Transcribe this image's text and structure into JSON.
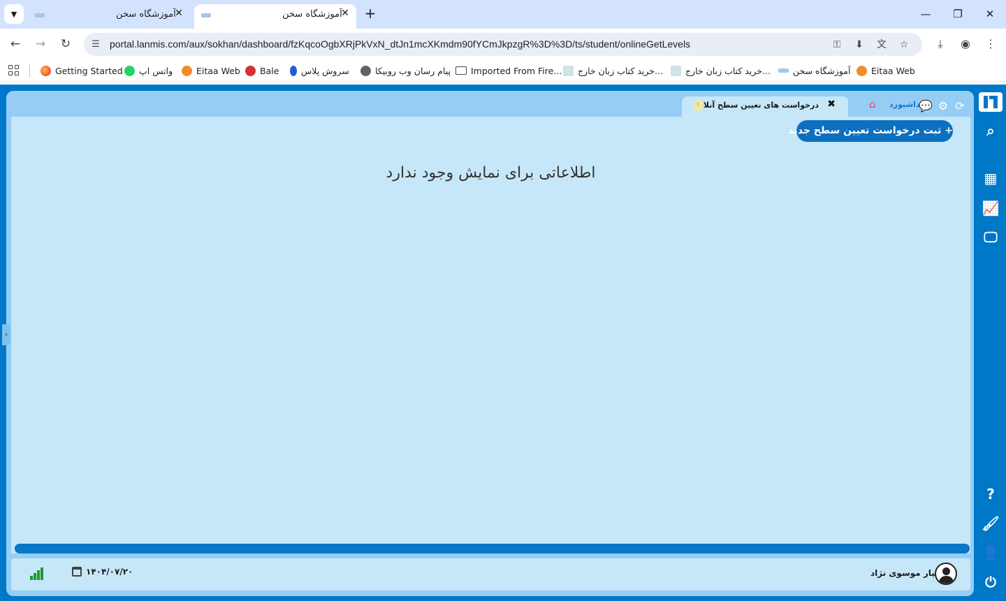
{
  "browser": {
    "tabs": [
      {
        "title": "آموزشگاه سخن",
        "active": false
      },
      {
        "title": "آموزشگاه سخن",
        "active": true
      }
    ],
    "url": "portal.lanmis.com/aux/sokhan/dashboard/fzKqcoOgbXRjPkVxN_dtJn1mcXKmdm90fYCmJkpzgR%3D%3D/ts/student/onlineGetLevels",
    "bookmarks": [
      {
        "label": "Getting Started",
        "icon": "firefox-icon"
      },
      {
        "label": "واتس اپ",
        "icon": "whatsapp-icon"
      },
      {
        "label": "Eitaa Web",
        "icon": "eitaa-icon"
      },
      {
        "label": "Bale",
        "icon": "bale-icon"
      },
      {
        "label": "سروش پلاس",
        "icon": "soroush-icon"
      },
      {
        "label": "پیام رسان وب روبیکا",
        "icon": "globe-icon"
      },
      {
        "label": "Imported From Fire...",
        "icon": "folder-icon"
      },
      {
        "label": "خرید کتاب زبان خارج...",
        "icon": "site-icon"
      },
      {
        "label": "خرید کتاب زبان خارج...",
        "icon": "site-icon"
      },
      {
        "label": "آموزشگاه سخن",
        "icon": "site-icon"
      },
      {
        "label": "Eitaa Web",
        "icon": "eitaa-icon"
      }
    ]
  },
  "app": {
    "dashboard_link": "داشبورد",
    "open_tab_label": "درخواست های تعیین سطح آنلاین",
    "new_request_button": "+ ثبت درخواست تعیین سطح جدید",
    "empty_message": "اطلاعاتی برای نمایش وجود ندارد",
    "status": {
      "user_name": "مهیار موسوی نژاد",
      "date": "۱۴۰۴/۰۷/۲۰"
    }
  },
  "colors": {
    "app_blue": "#0078c8",
    "panel_bg": "#95cdf5",
    "content_bg": "#c6e7f8",
    "button_blue": "#0d6fbf",
    "signal_green": "#1e9b2f"
  }
}
